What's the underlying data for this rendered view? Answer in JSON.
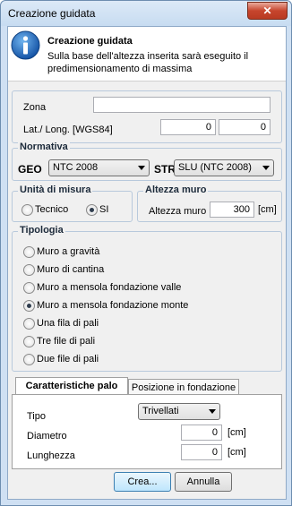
{
  "window": {
    "title": "Creazione guidata",
    "close_glyph": "✕"
  },
  "header": {
    "icon": "info-icon",
    "title": "Creazione guidata",
    "description": "Sulla base dell'altezza inserita sarà eseguito il predimensionamento di massima"
  },
  "location": {
    "zona_label": "Zona",
    "zona_value": "",
    "latlong_label": "Lat./ Long. [WGS84]",
    "lat_value": "0",
    "long_value": "0"
  },
  "normativa": {
    "title": "Normativa",
    "geo_label": "GEO",
    "geo_value": "NTC 2008",
    "str_label": "STR",
    "str_value": "SLU (NTC 2008)"
  },
  "units": {
    "title": "Unità di misura",
    "options": [
      "Tecnico",
      "SI"
    ],
    "selected": "SI"
  },
  "altezza": {
    "title": "Altezza muro",
    "label": "Altezza muro",
    "value": "300",
    "unit": "[cm]"
  },
  "tipologia": {
    "title": "Tipologia",
    "options": [
      "Muro a gravità",
      "Muro di cantina",
      "Muro a mensola fondazione valle",
      "Muro a mensola fondazione monte",
      "Una fila di pali",
      "Tre file di pali",
      "Due file di pali"
    ],
    "selected": "Muro a mensola fondazione monte"
  },
  "tabs": [
    "Caratteristiche palo",
    "Posizione in fondazione"
  ],
  "palo": {
    "tipo_label": "Tipo",
    "tipo_value": "Trivellati",
    "diametro_label": "Diametro",
    "diametro_value": "0",
    "diametro_unit": "[cm]",
    "lunghezza_label": "Lunghezza",
    "lunghezza_value": "0",
    "lunghezza_unit": "[cm]"
  },
  "buttons": {
    "create": "Crea...",
    "cancel": "Annulla"
  }
}
